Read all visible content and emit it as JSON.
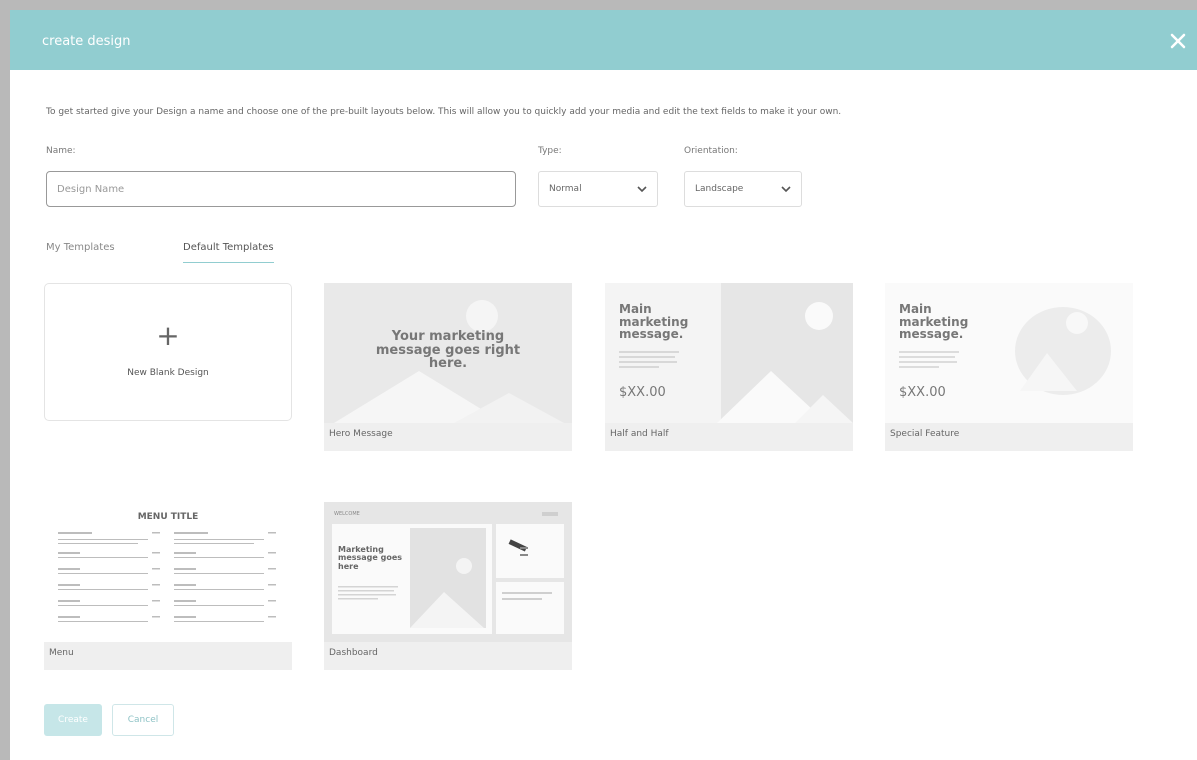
{
  "dialog": {
    "title": "create design",
    "close_icon": "close-icon",
    "intro": "To get started give your Design a name and choose one of the pre-built layouts below. This will allow you to quickly add your media and edit the text fields to make it your own."
  },
  "form": {
    "name_label": "Name:",
    "name_placeholder": "Design Name",
    "name_value": "",
    "type_label": "Type:",
    "type_value": "Normal",
    "orientation_label": "Orientation:",
    "orientation_value": "Landscape"
  },
  "tabs": [
    {
      "label": "My Templates",
      "active": false
    },
    {
      "label": "Default Templates",
      "active": true
    }
  ],
  "blank_card": {
    "icon": "plus-icon",
    "label": "New Blank Design"
  },
  "templates": [
    {
      "name": "Hero Message",
      "preview_text": "Your marketing message goes right here."
    },
    {
      "name": "Half and Half",
      "preview_title": "Main marketing message.",
      "preview_price": "$XX.00"
    },
    {
      "name": "Special Feature",
      "preview_title": "Main marketing message.",
      "preview_price": "$XX.00"
    },
    {
      "name": "Menu",
      "preview_title": "MENU TITLE"
    },
    {
      "name": "Dashboard",
      "preview_header": "WELCOME",
      "preview_title": "Marketing message goes here"
    }
  ],
  "buttons": {
    "create": "Create",
    "cancel": "Cancel"
  },
  "colors": {
    "header": "#91cdd0",
    "accent": "#91cdd0",
    "create_disabled": "#c6e6e8"
  }
}
